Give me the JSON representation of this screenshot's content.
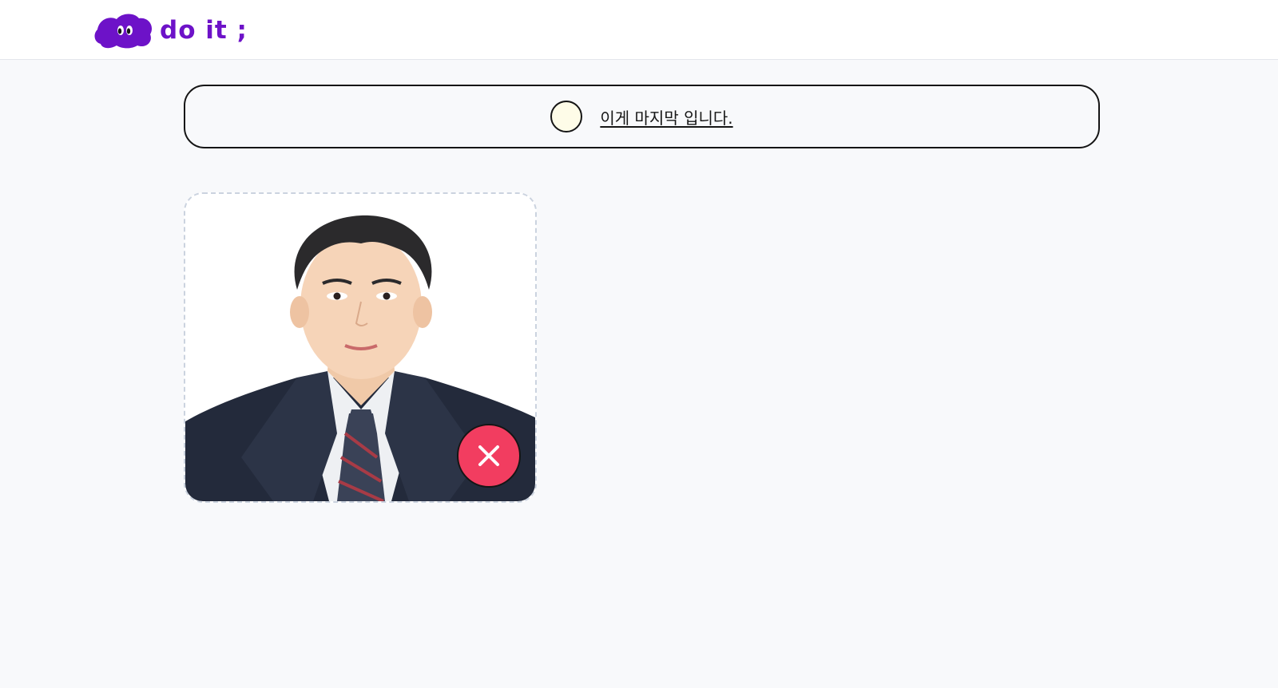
{
  "header": {
    "logo_text": "do it ;",
    "logo_icon": "cloud-mascot-icon",
    "brand_color": "#6d12c8"
  },
  "todo": {
    "text": "이게 마지막 입니다.",
    "completed": false,
    "checkbox_icon": "circle-checkbox-icon"
  },
  "image_card": {
    "alt": "Portrait photo of a man in a suit and tie",
    "delete_icon": "close-icon",
    "delete_color": "#f23d60"
  }
}
